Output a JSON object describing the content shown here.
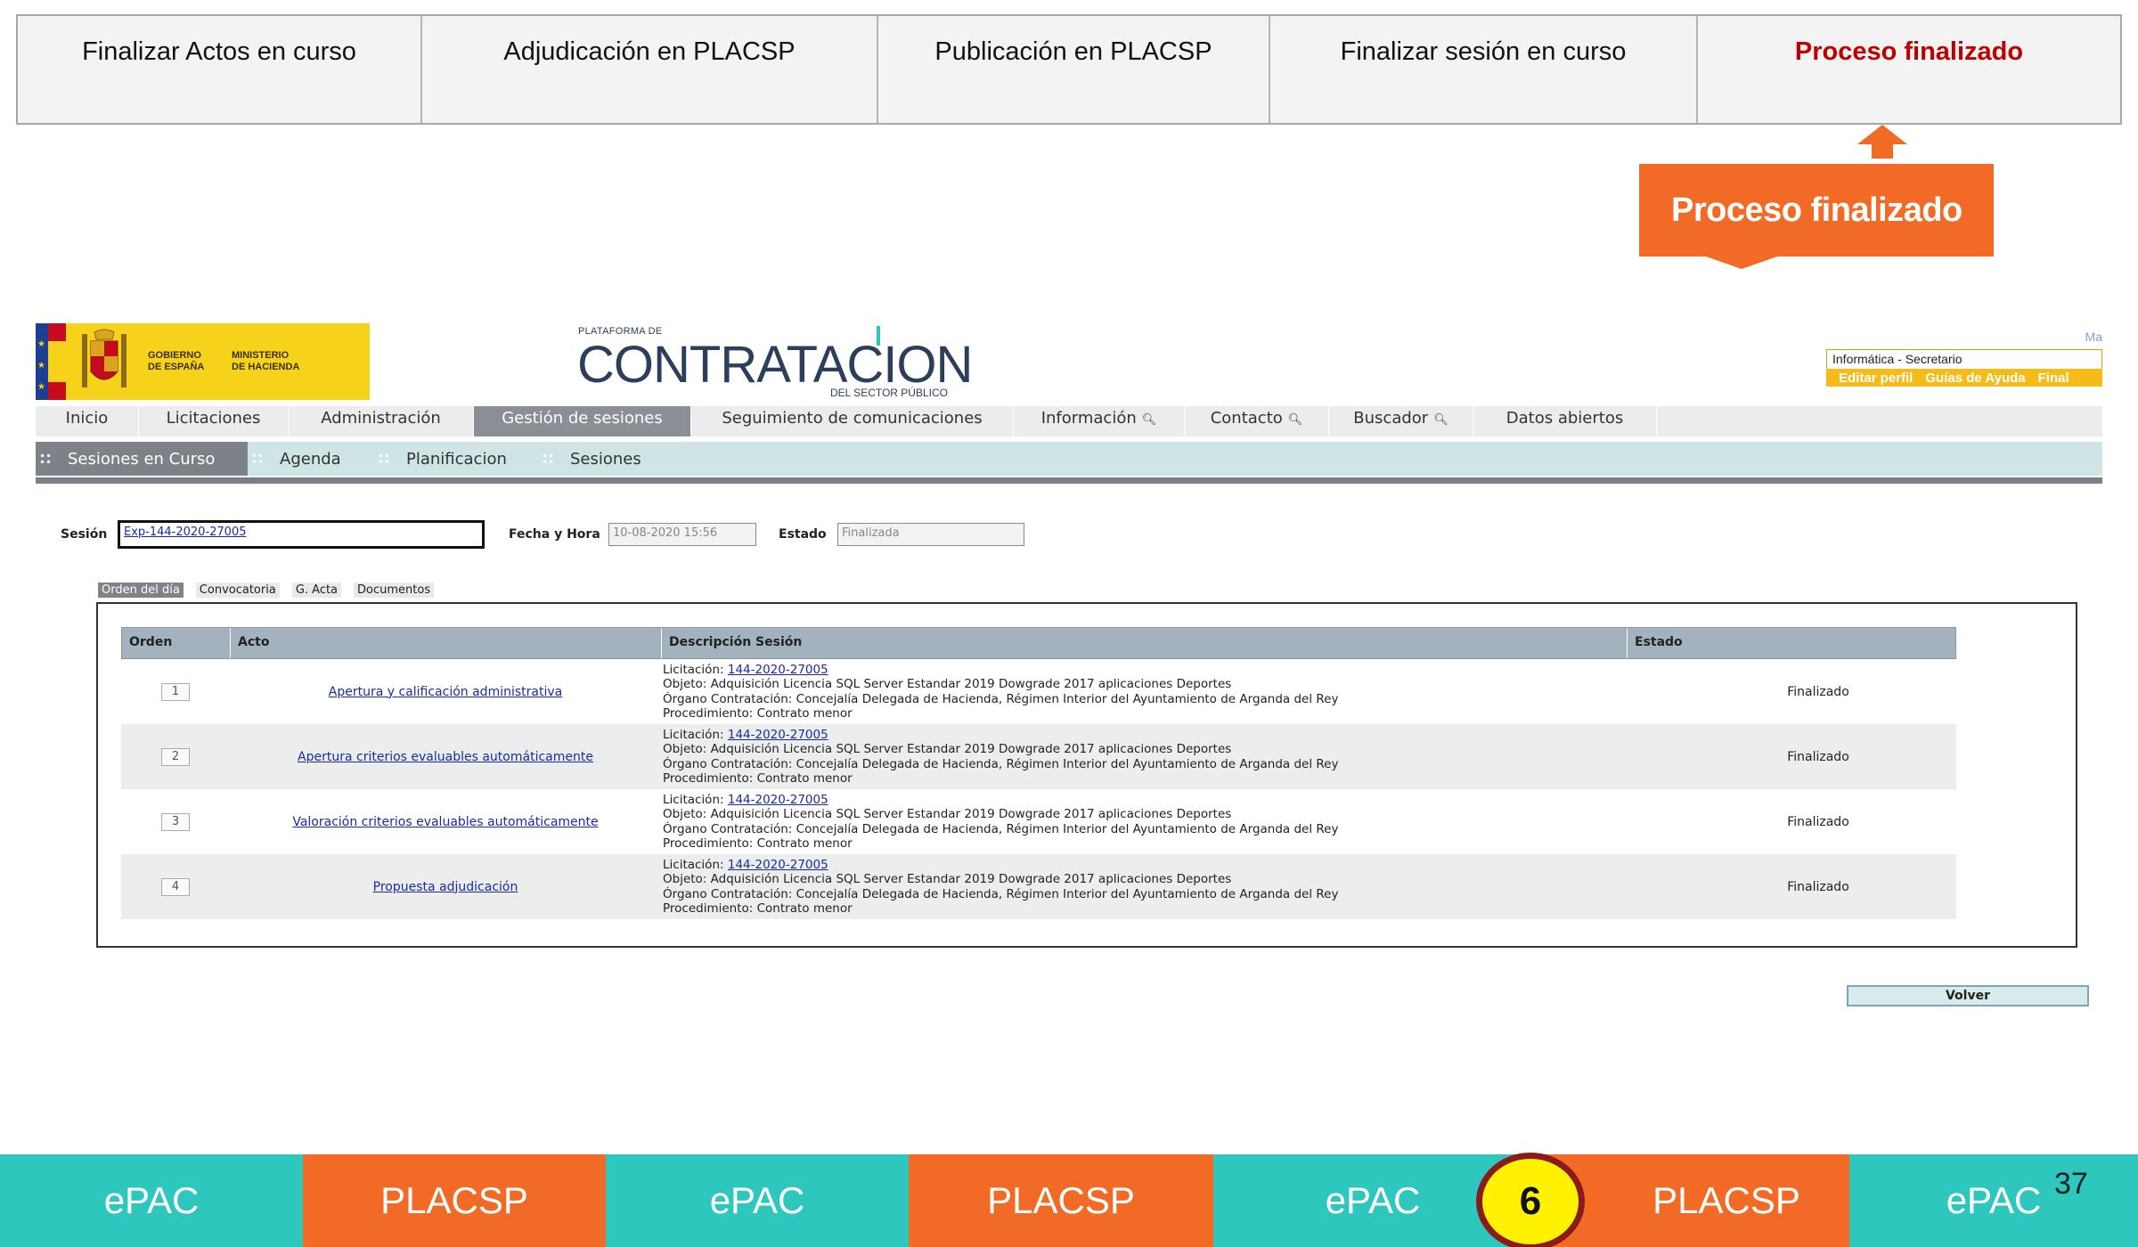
{
  "steps": [
    "Finalizar Actos en curso",
    "Adjudicación en PLACSP",
    "Publicación en PLACSP",
    "Finalizar sesión en curso",
    "Proceso finalizado"
  ],
  "callout": "Proceso finalizado",
  "logos": {
    "gov": "GOBIERNO DE ESPAÑA",
    "ministry": "MINISTERIO DE HACIENDA",
    "platform_small": "PLATAFORMA DE",
    "platform_big": "CONTRATACION",
    "platform_sub": "DEL SECTOR PÚBLICO"
  },
  "user": {
    "ma": "Ma",
    "who": "Informática - Secretario",
    "links": [
      "Editar perfil",
      "Guías de Ayuda",
      "Final"
    ]
  },
  "nav": [
    "Inicio",
    "Licitaciones",
    "Administración",
    "Gestión de sesiones",
    "Seguimiento de comunicaciones",
    "Información",
    "Contacto",
    "Buscador",
    "Datos abiertos"
  ],
  "subnav": [
    "Sesiones en Curso",
    "Agenda",
    "Planificacion",
    "Sesiones"
  ],
  "session": {
    "sesion_label": "Sesión",
    "sesion_value": "Exp-144-2020-27005",
    "fecha_label": "Fecha y Hora",
    "fecha_value": "10-08-2020 15:56",
    "estado_label": "Estado",
    "estado_value": "Finalizada"
  },
  "tabs": [
    "Orden del día",
    "Convocatoria",
    "G. Acta",
    "Documentos"
  ],
  "table": {
    "headers": [
      "Orden",
      "Acto",
      "Descripción Sesión",
      "Estado"
    ],
    "rows": [
      {
        "orden": "1",
        "acto": "Apertura y calificación administrativa",
        "licitacion_label": "Licitación:",
        "licitacion": "144-2020-27005",
        "objeto": "Objeto: Adquisición Licencia SQL Server Estandar 2019 Dowgrade 2017 aplicaciones Deportes",
        "organo": "Órgano Contratación: Concejalía Delegada de Hacienda, Régimen Interior del Ayuntamiento de Arganda del Rey",
        "procedimiento": "Procedimiento: Contrato menor",
        "estado": "Finalizado"
      },
      {
        "orden": "2",
        "acto": "Apertura criterios evaluables automáticamente",
        "licitacion_label": "Licitación:",
        "licitacion": "144-2020-27005",
        "objeto": "Objeto: Adquisición Licencia SQL Server Estandar 2019 Dowgrade 2017 aplicaciones Deportes",
        "organo": "Órgano Contratación: Concejalía Delegada de Hacienda, Régimen Interior del Ayuntamiento de Arganda del Rey",
        "procedimiento": "Procedimiento: Contrato menor",
        "estado": "Finalizado"
      },
      {
        "orden": "3",
        "acto": "Valoración criterios evaluables automáticamente",
        "licitacion_label": "Licitación:",
        "licitacion": "144-2020-27005",
        "objeto": "Objeto: Adquisición Licencia SQL Server Estandar 2019 Dowgrade 2017 aplicaciones Deportes",
        "organo": "Órgano Contratación: Concejalía Delegada de Hacienda, Régimen Interior del Ayuntamiento de Arganda del Rey",
        "procedimiento": "Procedimiento: Contrato menor",
        "estado": "Finalizado"
      },
      {
        "orden": "4",
        "acto": "Propuesta adjudicación",
        "licitacion_label": "Licitación:",
        "licitacion": "144-2020-27005",
        "objeto": "Objeto: Adquisición Licencia SQL Server Estandar 2019 Dowgrade 2017 aplicaciones Deportes",
        "organo": "Órgano Contratación: Concejalía Delegada de Hacienda, Régimen Interior del Ayuntamiento de Arganda del Rey",
        "procedimiento": "Procedimiento: Contrato menor",
        "estado": "Finalizado"
      }
    ]
  },
  "volver": "Volver",
  "ribbon": [
    "ePAC",
    "PLACSP",
    "ePAC",
    "PLACSP",
    "ePAC",
    "PLACSP",
    "ePAC"
  ],
  "badge": "6",
  "page_number": "37",
  "colors": {
    "orange": "#f26b26",
    "teal": "#2ec7be",
    "active_step": "#c00000",
    "badge_fill": "#fff200",
    "badge_ring": "#8b1a1a"
  }
}
